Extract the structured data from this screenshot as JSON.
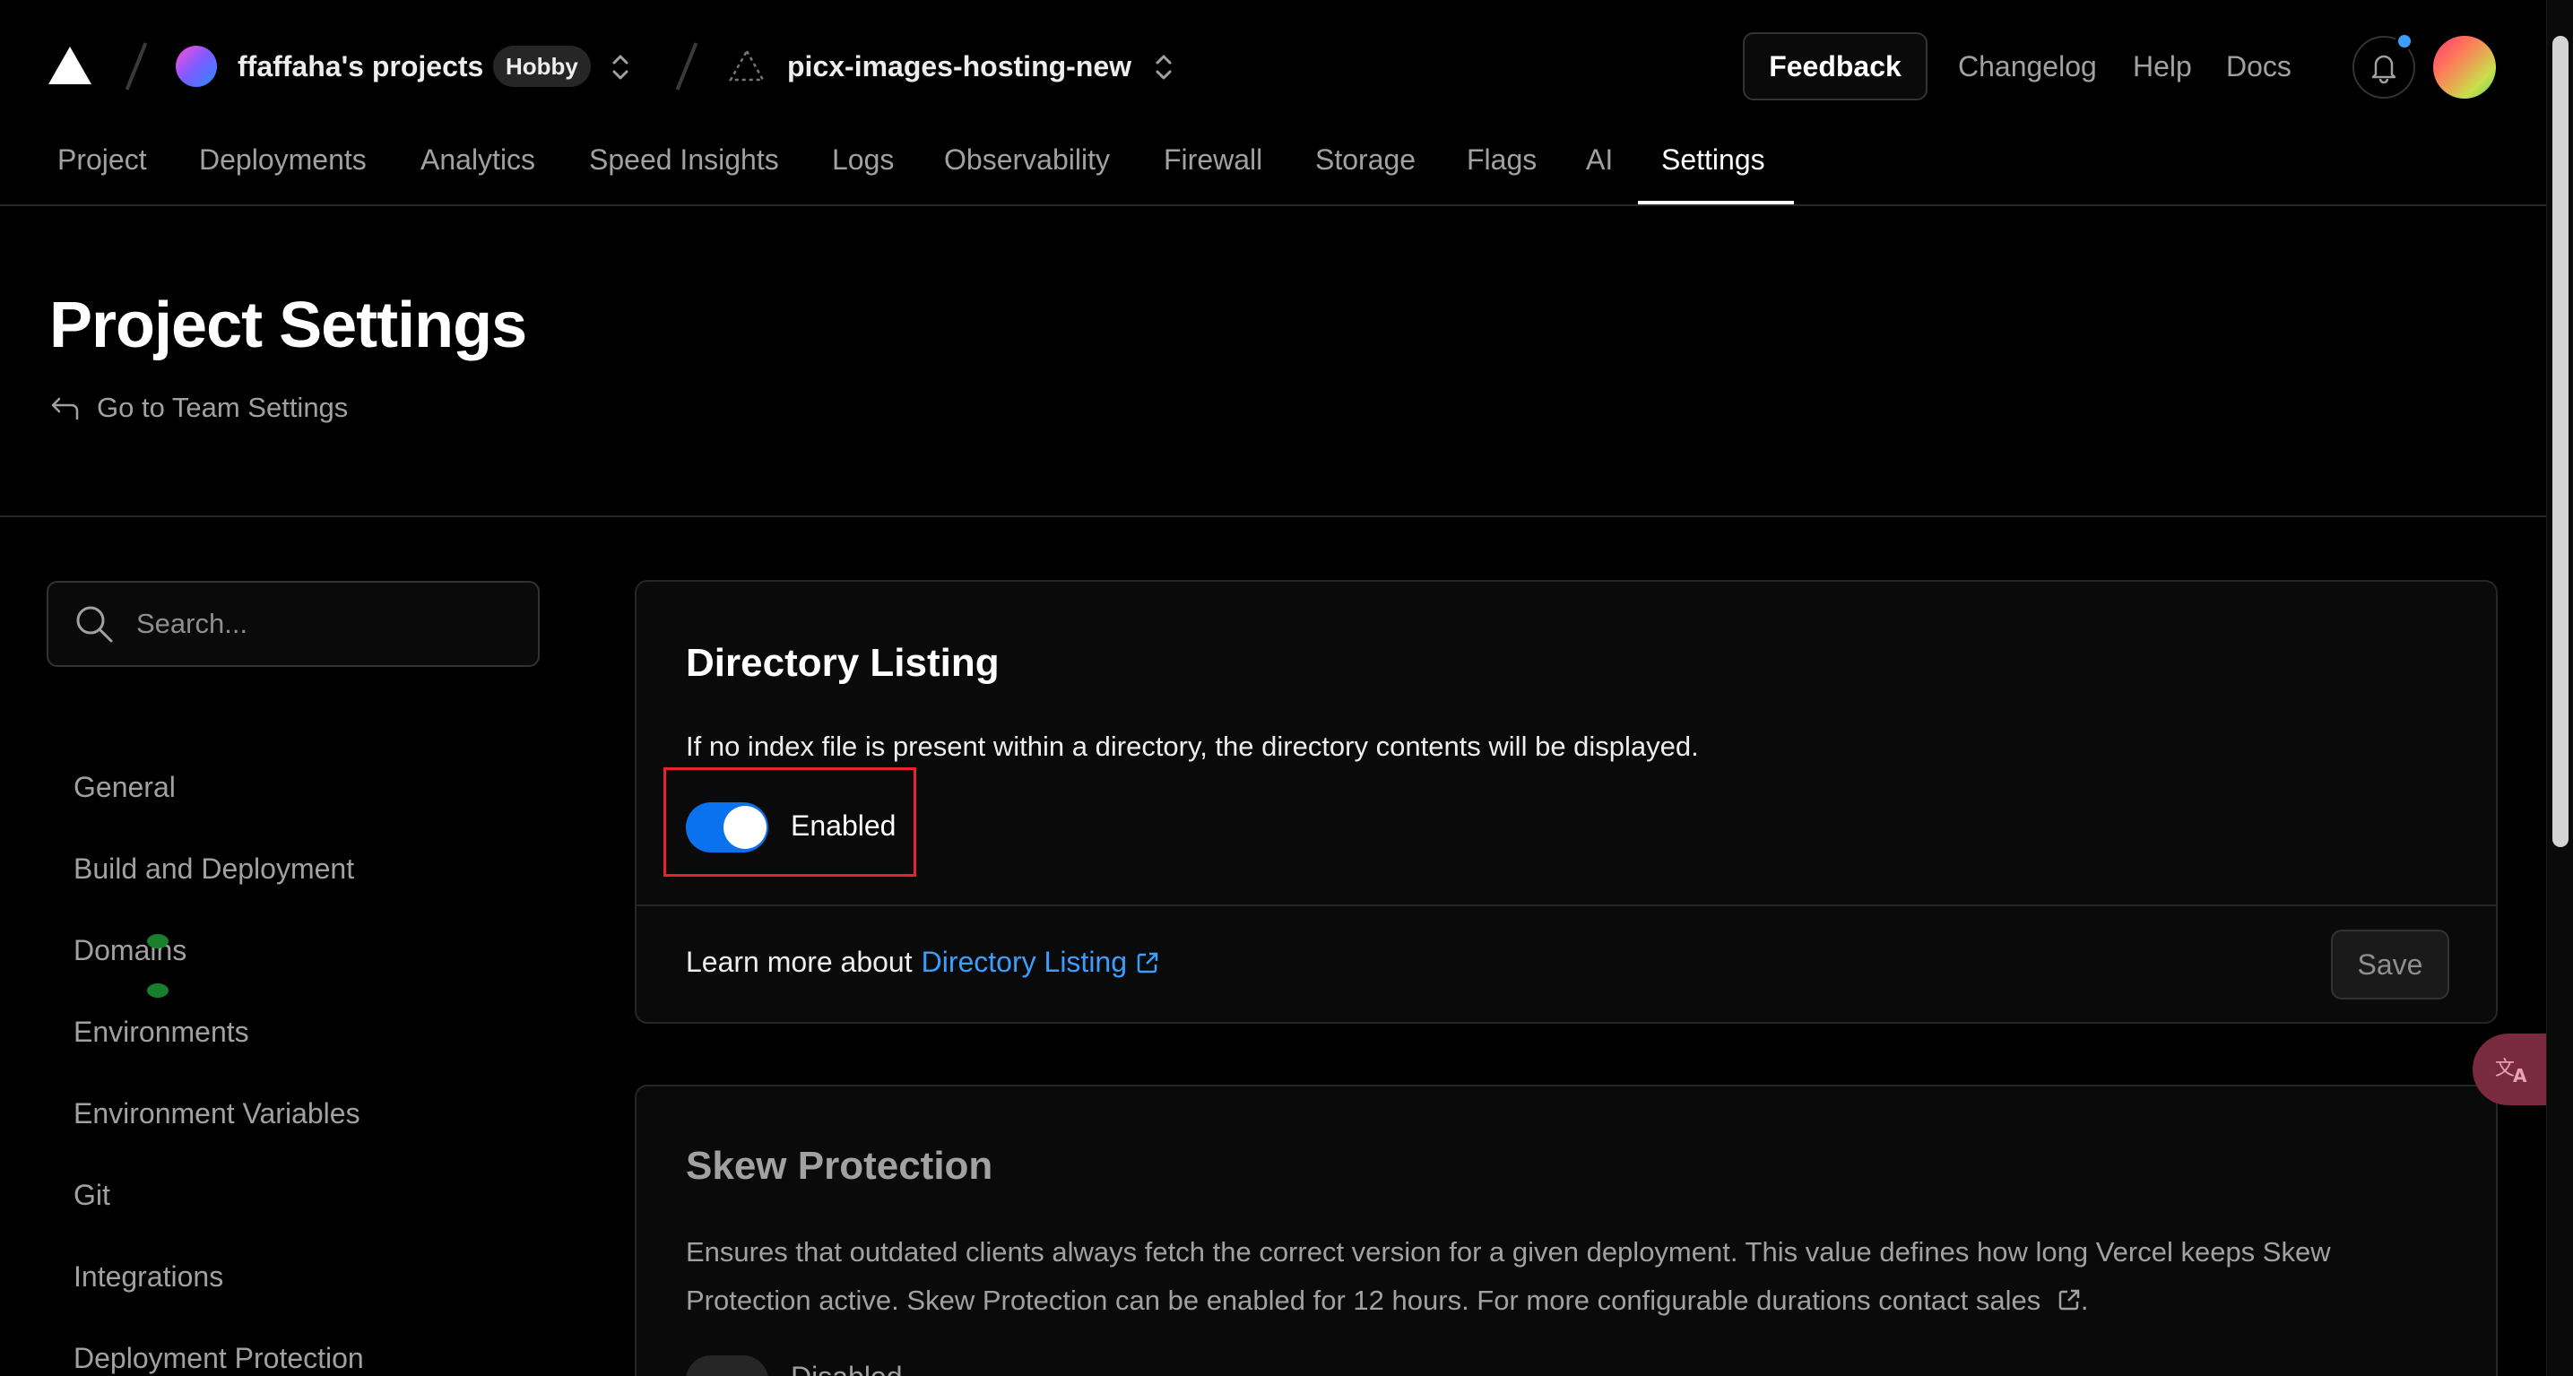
{
  "topbar": {
    "team_name": "ffaffaha's projects",
    "plan_badge": "Hobby",
    "project_name": "picx-images-hosting-new",
    "feedback_label": "Feedback",
    "links": [
      "Changelog",
      "Help",
      "Docs"
    ]
  },
  "tabs": [
    "Project",
    "Deployments",
    "Analytics",
    "Speed Insights",
    "Logs",
    "Observability",
    "Firewall",
    "Storage",
    "Flags",
    "AI",
    "Settings"
  ],
  "active_tab": "Settings",
  "header": {
    "title": "Project Settings",
    "back_link": "Go to Team Settings"
  },
  "sidebar": {
    "search_placeholder": "Search...",
    "items": [
      "General",
      "Build and Deployment",
      "Domains",
      "Environments",
      "Environment Variables",
      "Git",
      "Integrations",
      "Deployment Protection"
    ]
  },
  "directory_listing": {
    "title": "Directory Listing",
    "description": "If no index file is present within a directory, the directory contents will be displayed.",
    "toggle_label": "Enabled",
    "toggle_on": true,
    "learn_more_prefix": "Learn more about",
    "learn_more_link": "Directory Listing",
    "save_label": "Save"
  },
  "skew_protection": {
    "title": "Skew Protection",
    "description": "Ensures that outdated clients always fetch the correct version for a given deployment. This value defines how long Vercel keeps Skew Protection active. Skew Protection can be enabled for 12 hours. For more configurable durations contact sales",
    "toggle_label": "Disabled",
    "toggle_on": false
  },
  "colors": {
    "accent_blue": "#0a72ef",
    "link_blue": "#3b9eff",
    "highlight_red": "#e5252a"
  }
}
